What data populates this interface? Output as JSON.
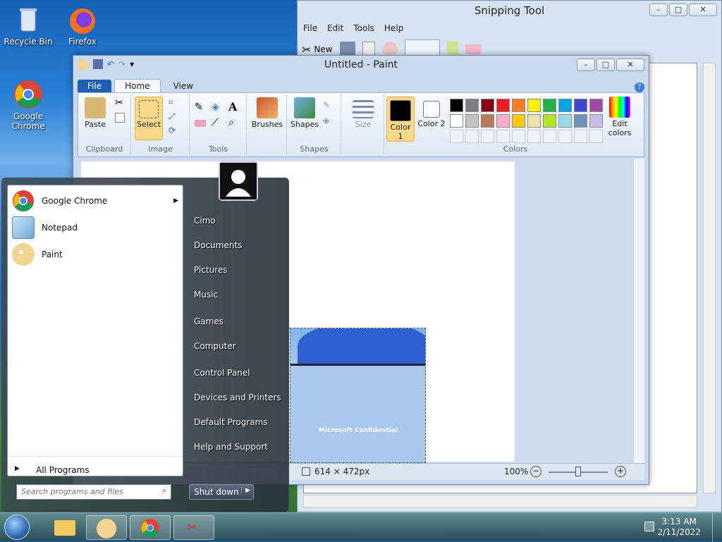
{
  "desktop": {
    "icons": [
      {
        "label": "Recycle Bin"
      },
      {
        "label": "Firefox"
      },
      {
        "label": "Google Chrome"
      }
    ]
  },
  "snipping": {
    "title": "Snipping Tool",
    "menu": [
      "File",
      "Edit",
      "Tools",
      "Help"
    ],
    "new_label": "New"
  },
  "paint": {
    "title": "Untitled - Paint",
    "tabs": {
      "file": "File",
      "home": "Home",
      "view": "View"
    },
    "groups": {
      "clipboard": "Clipboard",
      "image": "Image",
      "tools": "Tools",
      "shapes": "Shapes",
      "colors": "Colors"
    },
    "buttons": {
      "paste": "Paste",
      "select": "Select",
      "brushes": "Brushes",
      "shapes": "Shapes",
      "size": "Size",
      "color1": "Color 1",
      "color2": "Color 2",
      "edit_colors": "Edit colors"
    },
    "palette_row1": [
      "#000000",
      "#7f7f7f",
      "#880015",
      "#ed1c24",
      "#ff7f27",
      "#fff200",
      "#22b14c",
      "#00a2e8",
      "#3f48cc",
      "#a349a4"
    ],
    "palette_row2": [
      "#ffffff",
      "#c3c3c3",
      "#b97a57",
      "#ffaec9",
      "#ffc90e",
      "#efe4b0",
      "#b5e61d",
      "#99d9ea",
      "#7092be",
      "#c8bfe7"
    ],
    "status": {
      "dimensions": "614 × 472px",
      "zoom": "100%"
    },
    "image_text": "Microsoft Confidential"
  },
  "start_menu": {
    "programs": [
      {
        "label": "Google Chrome",
        "has_arrow": true
      },
      {
        "label": "Notepad"
      },
      {
        "label": "Paint"
      }
    ],
    "all_programs": "All Programs",
    "search_placeholder": "Search programs and files",
    "right_items": [
      "Cimo",
      "Documents",
      "Pictures",
      "Music",
      "Games",
      "Computer",
      "Control Panel",
      "Devices and Printers",
      "Default Programs",
      "Help and Support"
    ],
    "shutdown": "Shut down"
  },
  "taskbar": {
    "time": "3:13 AM",
    "date": "2/11/2022"
  }
}
